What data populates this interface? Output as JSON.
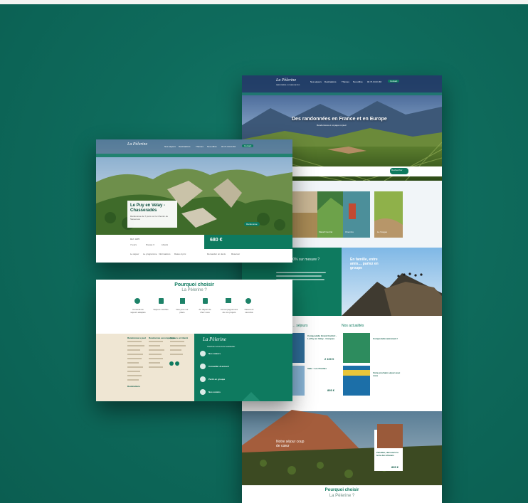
{
  "brand": {
    "logo": "La Pèlerine",
    "tagline": "RANDONNÉES & VOYAGES À PIED",
    "accent": "#0e7a5f",
    "cream": "#efe6d3"
  },
  "site_a": {
    "nav": [
      "Nos séjours",
      "Destinations",
      "Thèmes",
      "Nos offres"
    ],
    "phone": "04 71 04 21 66",
    "cta": "Contact",
    "hero_title": "Des randonnées en France et en Europe",
    "hero_subtitle": "Randonnées et voyages à pied",
    "search_button": "Rechercher",
    "cards": [
      "Massif Central",
      "Chemins",
      "La Vosges"
    ],
    "promo_title": "… pour 100% sur mesure ?",
    "family_title": "En famille, entre amis… partez en groupe",
    "section_sejours": "… séjours",
    "section_actus": "Nos actualités",
    "product1_title": "Compostelle Grand Confort - Le Puy en Velay - Conques",
    "product1_price": "2 100 €",
    "product2_title": "Italie : Les Pouilles",
    "product2_price": "895 €",
    "actu1_title": "Compostelle autrement !",
    "actu2_title": "Votre prochain séjour avec nous",
    "banner_title": "Notre séjour coup de cœur",
    "card_title": "Zanzibar, découvrir la terre des Volcans",
    "card_price": "895 €",
    "footer_heading": "Pourquoi choisir",
    "footer_sub": "La Pèlerine ?"
  },
  "site_b": {
    "nav": [
      "Nos séjours",
      "Destinations",
      "Thèmes",
      "Nos offres"
    ],
    "phone": "04 71 04 21 66",
    "cta": "Contact",
    "title": "Le Puy en Velay - Chasseradès",
    "desc": "Randonnée de 7 jours sur le Chemin de Stevenson",
    "badge": "Randonnée",
    "price": "680 €",
    "info": [
      "Réf. 1205",
      "7 jours",
      "Niveau 3",
      "Liberté"
    ],
    "tabs": [
      "Le séjour",
      "Le programme",
      "Informations",
      "Dates & prix"
    ],
    "actions": [
      "Demander un devis",
      "Réserver"
    ]
  },
  "site_c": {
    "heading": "Pourquoi choisir",
    "sub": "La Pèlerine ?",
    "features": [
      "Conseils de séjours adaptés",
      "Séjours certifiés",
      "Des pros sur place",
      "Au départ de chez vous",
      "Accompagnement de vos projets",
      "Paiement sécurisé"
    ],
    "footer_cols": [
      "Randonnée à pied",
      "Randonnée accompagnée",
      "Séjours en liberté",
      "Destinations"
    ],
    "footer_links": [
      "Nos séjours",
      "Nos offres",
      "Qui sommes-nous",
      "Contact"
    ],
    "footer_logo": "La Pèlerine",
    "footer_newsletter": "Inscrivez-vous à la newsletter",
    "features_right": [
      "Nos valeurs",
      "Conseiller & accueil",
      "Partir en groupe",
      "Nos voisins"
    ]
  }
}
